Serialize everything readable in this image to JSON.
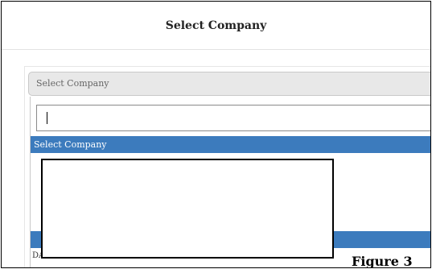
{
  "modal": {
    "title": "Select Company"
  },
  "company_select": {
    "placeholder": "Select Company",
    "search_value": "",
    "options": [
      "Select Company",
      "DATA CHAND BUILDCON PRIVATE LIMITED"
    ]
  },
  "figure": {
    "caption": "Figure 3"
  },
  "colors": {
    "highlight": "#3c7bbd",
    "select_background": "#e8e8e8"
  }
}
